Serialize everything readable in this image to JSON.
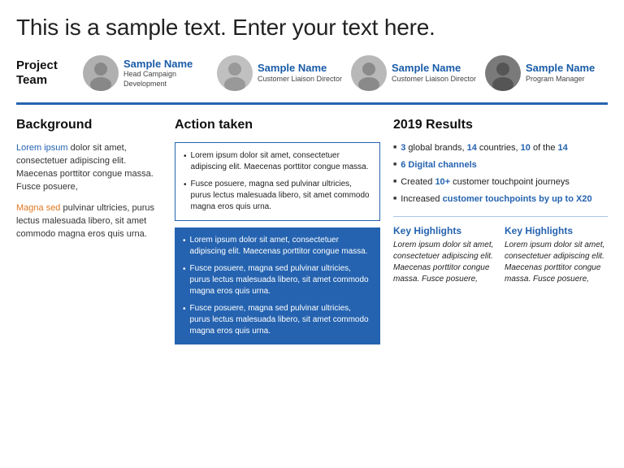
{
  "header": {
    "title": "This is a sample text. Enter your text here."
  },
  "projectTeam": {
    "label": "Project Team",
    "members": [
      {
        "name": "Sample Name",
        "role": "Head Campaign Development"
      },
      {
        "name": "Sample Name",
        "role": "Customer Liaison Director"
      },
      {
        "name": "Sample Name",
        "role": "Customer Liaison Director"
      },
      {
        "name": "Sample Name",
        "role": "Program Manager"
      }
    ]
  },
  "background": {
    "title": "Background",
    "paragraphs": [
      {
        "highlight": "Lorem ipsum",
        "highlightColor": "blue",
        "rest": " dolor sit amet, consectetuer adipiscing elit. Maecenas porttitor congue massa. Fusce posuere,"
      },
      {
        "highlight": "Magna sed",
        "highlightColor": "orange",
        "rest": " pulvinar ultricies, purus lectus malesuada libero, sit amet commodo magna eros quis urna."
      }
    ]
  },
  "actionTaken": {
    "title": "Action taken",
    "whiteBoxItems": [
      "Lorem ipsum dolor sit amet, consectetuer adipiscing elit. Maecenas porttitor congue massa.",
      "Fusce posuere, magna sed pulvinar ultricies, purus lectus malesuada libero, sit amet commodo magna eros quis urna."
    ],
    "blueBoxItems": [
      "Lorem ipsum dolor sit amet, consectetuer adipiscing elit. Maecenas porttitor congue massa.",
      "Fusce posuere, magna sed pulvinar ultricies, purus lectus malesuada libero, sit amet commodo magna eros quis urna.",
      "Fusce posuere, magna sed pulvinar ultricies, purus lectus malesuada libero, sit amet commodo magna eros quis urna."
    ]
  },
  "results": {
    "title": "2019 Results",
    "items": [
      {
        "text": "3",
        "bold": true,
        "color": "blue",
        "rest": " global brands, ",
        "bold2": "14",
        "rest2": " countries, ",
        "bold3": "10",
        "rest3": " of the ",
        "bold4": "14",
        "rest4": ""
      },
      {
        "text": "6 Digital channels",
        "bold": true,
        "color": "blue"
      },
      {
        "prefix": "Created ",
        "bold": "10+",
        "boldColor": "blue",
        "rest": " customer touchpoint journeys"
      },
      {
        "prefix": "Increased ",
        "bold": "customer touchpoints by up to X20",
        "boldColor": "blue"
      }
    ],
    "highlights": [
      {
        "title": "Key Highlights",
        "text": "Lorem ipsum dolor sit amet, consectetuer adipiscing elit. Maecenas porttitor congue massa. Fusce posuere,"
      },
      {
        "title": "Key Highlights",
        "text": "Lorem ipsum dolor sit amet, consectetuer adipiscing elit. Maecenas porttitor congue massa. Fusce posuere,"
      }
    ]
  }
}
